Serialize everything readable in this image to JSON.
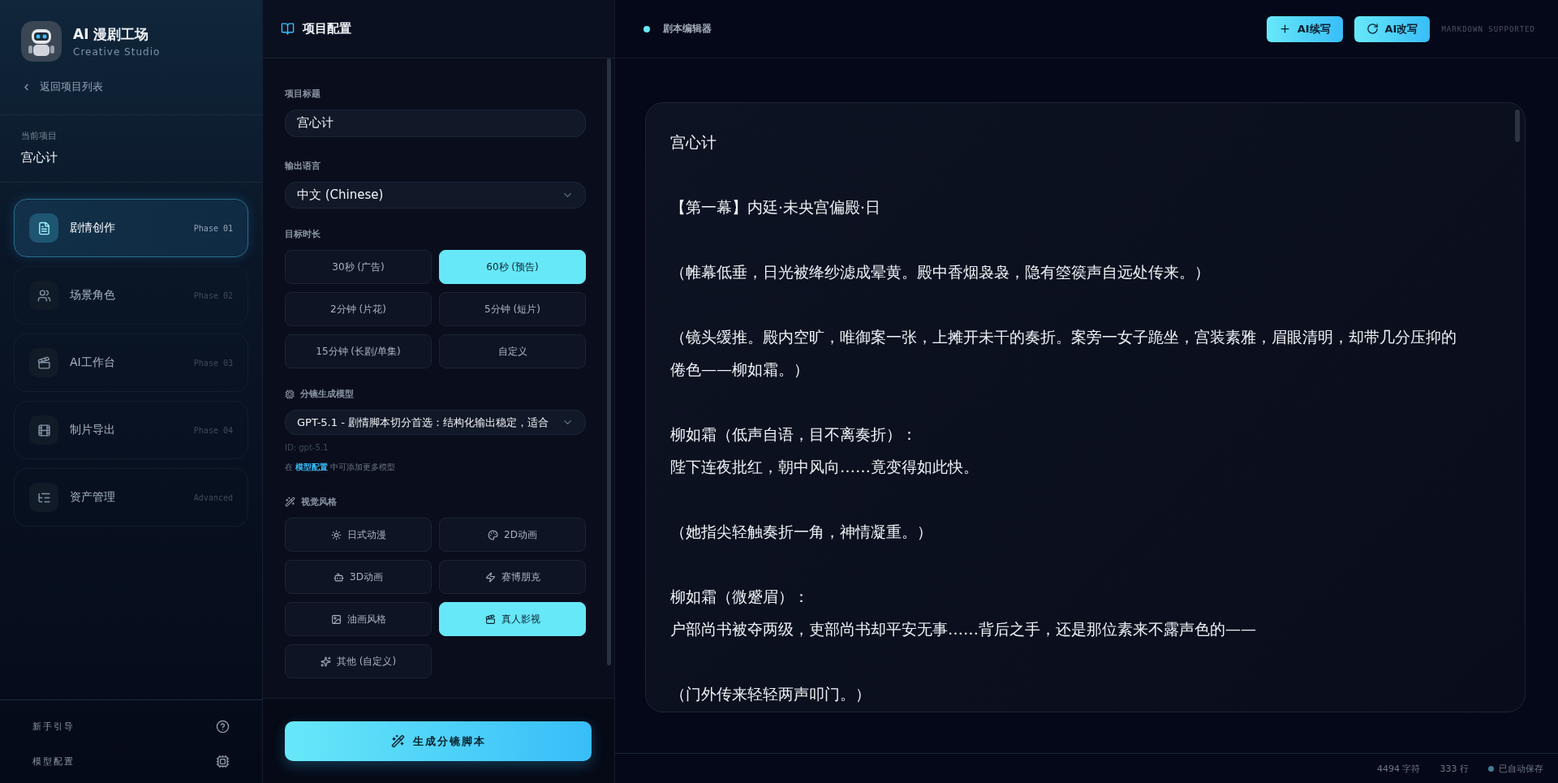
{
  "brand": {
    "title": "AI 漫剧工场",
    "subtitle": "Creative Studio"
  },
  "back_link": "返回项目列表",
  "current_project": {
    "label": "当前项目",
    "name": "宫心计"
  },
  "nav": [
    {
      "label": "剧情创作",
      "phase": "Phase 01",
      "selected": true
    },
    {
      "label": "场景角色",
      "phase": "Phase 02",
      "selected": false
    },
    {
      "label": "AI工作台",
      "phase": "Phase 03",
      "selected": false
    },
    {
      "label": "制片导出",
      "phase": "Phase 04",
      "selected": false
    },
    {
      "label": "资产管理",
      "phase": "Advanced",
      "selected": false
    }
  ],
  "sidebar_footer": [
    {
      "label": "新手引导"
    },
    {
      "label": "模型配置"
    }
  ],
  "config": {
    "title": "项目配置",
    "project_title": {
      "label": "项目标题",
      "value": "宫心计"
    },
    "language": {
      "label": "输出语言",
      "value": "中文 (Chinese)"
    },
    "duration": {
      "label": "目标时长",
      "options": [
        {
          "label": "30秒 (广告)",
          "selected": false
        },
        {
          "label": "60秒 (预告)",
          "selected": true
        },
        {
          "label": "2分钟 (片花)",
          "selected": false
        },
        {
          "label": "5分钟 (短片)",
          "selected": false
        },
        {
          "label": "15分钟 (长剧/单集)",
          "selected": false
        },
        {
          "label": "自定义",
          "selected": false
        }
      ]
    },
    "model": {
      "label": "分镜生成模型",
      "value": "GPT-5.1 - 剧情脚本切分首选：结构化输出稳定，适合",
      "id": "ID: gpt-5.1",
      "hint_before": "在",
      "hint_link": "模型配置",
      "hint_after": "中可添加更多模型"
    },
    "style": {
      "label": "视觉风格",
      "options": [
        {
          "label": "日式动漫",
          "selected": false
        },
        {
          "label": "2D动画",
          "selected": false
        },
        {
          "label": "3D动画",
          "selected": false
        },
        {
          "label": "赛博朋克",
          "selected": false
        },
        {
          "label": "油画风格",
          "selected": false
        },
        {
          "label": "真人影视",
          "selected": true
        },
        {
          "label": "其他 (自定义)",
          "selected": false
        }
      ]
    },
    "generate_button": "生成分镜脚本"
  },
  "editor": {
    "title": "剧本编辑器",
    "buttons": [
      "AI续写",
      "AI改写"
    ],
    "format_note": "MARKDOWN SUPPORTED",
    "blocks": [
      [
        "宫心计"
      ],
      [
        "【第一幕】内廷·未央宫偏殿·日"
      ],
      [
        "（帷幕低垂，日光被绛纱滤成晕黄。殿中香烟袅袅，隐有箜篌声自远处传来。）"
      ],
      [
        "（镜头缓推。殿内空旷，唯御案一张，上摊开未干的奏折。案旁一女子跪坐，宫装素雅，眉眼清明，却带几分压抑的倦色——柳如霜。）"
      ],
      [
        "柳如霜（低声自语，目不离奏折）：",
        "陛下连夜批红，朝中风向……竟变得如此快。"
      ],
      [
        "（她指尖轻触奏折一角，神情凝重。）"
      ],
      [
        "柳如霜（微蹙眉）：",
        "户部尚书被夺两级，吏部尚书却平安无事……背后之手，还是那位素来不露声色的——"
      ],
      [
        "（门外传来轻轻两声叩门。）"
      ]
    ]
  },
  "status_bar": {
    "chars": "4494 字符",
    "lines": "333 行",
    "saved": "已自动保存"
  }
}
